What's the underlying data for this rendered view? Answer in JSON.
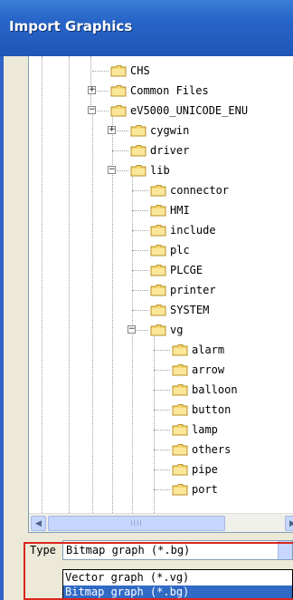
{
  "window": {
    "title": "Import Graphics"
  },
  "tree": {
    "nodes": [
      {
        "label": "CHS",
        "depth": 0,
        "expander": ""
      },
      {
        "label": "Common Files",
        "depth": 0,
        "expander": "+"
      },
      {
        "label": "eV5000_UNICODE_ENU",
        "depth": 0,
        "expander": "−"
      },
      {
        "label": "cygwin",
        "depth": 1,
        "expander": "+"
      },
      {
        "label": "driver",
        "depth": 1,
        "expander": ""
      },
      {
        "label": "lib",
        "depth": 1,
        "expander": "−"
      },
      {
        "label": "connector",
        "depth": 2,
        "expander": ""
      },
      {
        "label": "HMI",
        "depth": 2,
        "expander": ""
      },
      {
        "label": "include",
        "depth": 2,
        "expander": ""
      },
      {
        "label": "plc",
        "depth": 2,
        "expander": ""
      },
      {
        "label": "PLCGE",
        "depth": 2,
        "expander": ""
      },
      {
        "label": "printer",
        "depth": 2,
        "expander": ""
      },
      {
        "label": "SYSTEM",
        "depth": 2,
        "expander": ""
      },
      {
        "label": "vg",
        "depth": 2,
        "expander": "−"
      },
      {
        "label": "alarm",
        "depth": 3,
        "expander": ""
      },
      {
        "label": "arrow",
        "depth": 3,
        "expander": ""
      },
      {
        "label": "balloon",
        "depth": 3,
        "expander": ""
      },
      {
        "label": "button",
        "depth": 3,
        "expander": ""
      },
      {
        "label": "lamp",
        "depth": 3,
        "expander": ""
      },
      {
        "label": "others",
        "depth": 3,
        "expander": ""
      },
      {
        "label": "pipe",
        "depth": 3,
        "expander": ""
      },
      {
        "label": "port",
        "depth": 3,
        "expander": ""
      }
    ]
  },
  "scrollbars": {
    "up_arrow": "▲",
    "down_arrow": "▼",
    "left_arrow": "◀",
    "right_arrow": "▶",
    "h_thumb_grip": "IIII"
  },
  "type_field": {
    "label": "Type",
    "selected": "Bitmap graph (*.bg)",
    "options": [
      "Vector graph (*.vg)",
      "Bitmap graph (*.bg)"
    ],
    "highlighted_option_index": 1
  },
  "colors": {
    "titlebar": "#2865c8",
    "folder": "#f5d76e",
    "selection": "#316ac5",
    "highlight_box": "#d8261e"
  }
}
